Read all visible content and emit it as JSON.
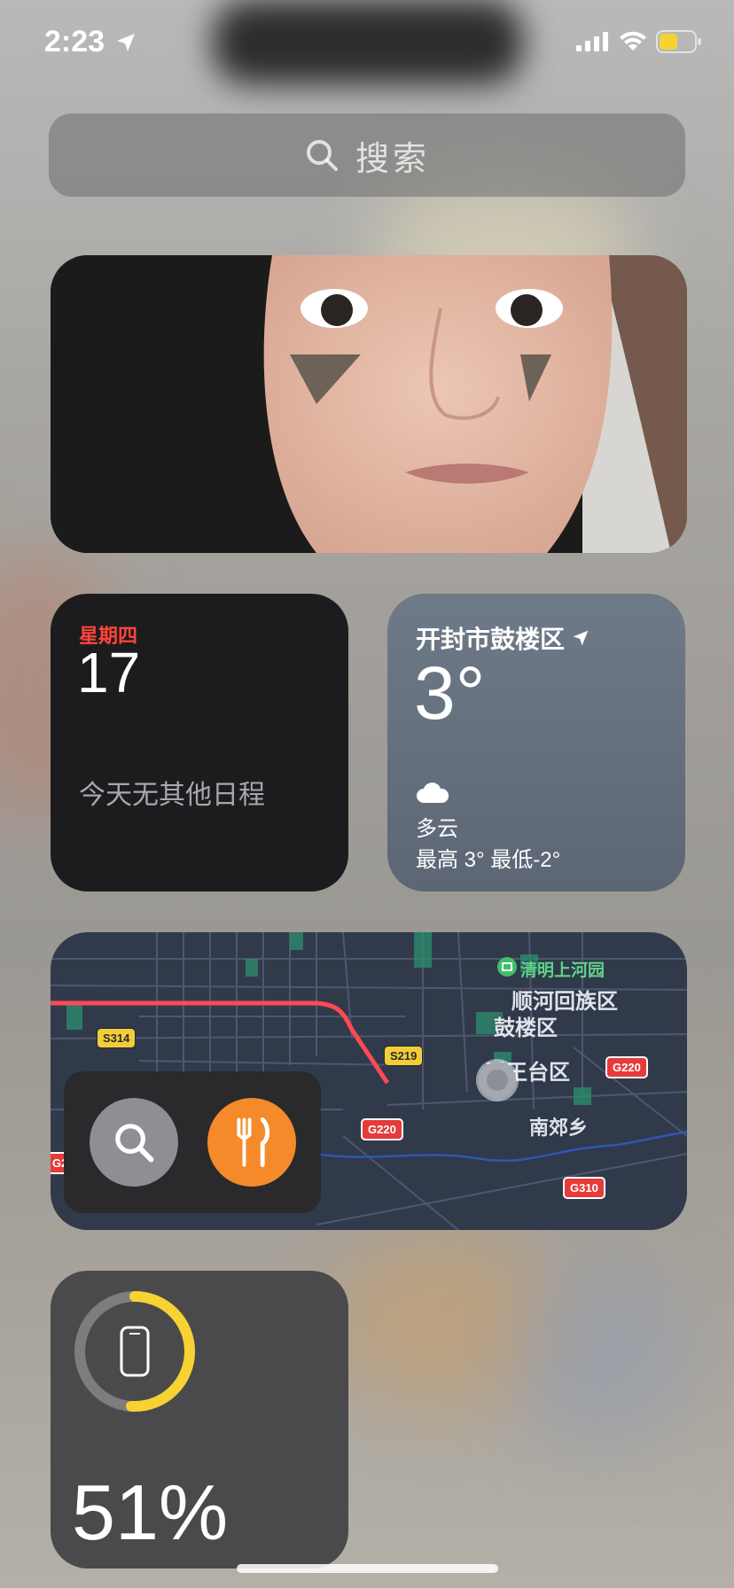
{
  "status_bar": {
    "time": "2:23",
    "battery_level": 0.5,
    "battery_color": "#f7d233"
  },
  "search": {
    "placeholder": "搜索"
  },
  "photo_widget": {
    "description_icon": "photo"
  },
  "calendar_widget": {
    "weekday": "星期四",
    "day": "17",
    "note": "今天无其他日程"
  },
  "weather_widget": {
    "city": "开封市鼓楼区",
    "temperature": "3°",
    "condition_icon": "cloud-icon",
    "condition": "多云",
    "range": "最高 3° 最低-2°"
  },
  "map_widget": {
    "labels": {
      "park": "清明上河园",
      "district1": "顺河回族区",
      "district2": "鼓楼区",
      "district3": "禹王台区",
      "town": "南郊乡"
    },
    "roads": {
      "s314": "S314",
      "s219": "S219",
      "g220a": "G220",
      "g220b": "G220",
      "g310": "G310",
      "g22": "G2"
    },
    "actions": [
      "search-icon",
      "fork-knife-icon"
    ]
  },
  "battery_widget": {
    "percent": "51%",
    "level": 0.51,
    "ring_color": "#f7d233"
  }
}
